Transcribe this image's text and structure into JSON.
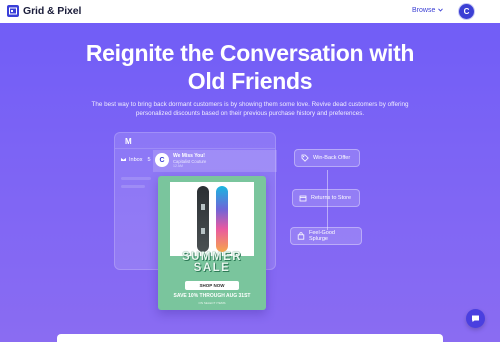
{
  "nav": {
    "brand": "Grid & Pixel",
    "browse_label": "Browse",
    "avatar_initial": "C"
  },
  "hero": {
    "title_line1": "Reignite the Conversation with",
    "title_line2": "Old Friends",
    "subtitle": "The best way to bring back dormant customers is by showing them some love. Revive dead customers by offering personalized discounts based on their previous purchase history and preferences."
  },
  "mail": {
    "logo": "M",
    "inbox_label": "Inbox",
    "inbox_count": "5",
    "email": {
      "avatar_initial": "C",
      "subject": "We Miss You!",
      "sender": "Capitalist Couture",
      "time": "12 AM"
    }
  },
  "promo": {
    "title_line1": "SUMMER",
    "title_line2": "SALE",
    "button": "SHOP NOW",
    "save_text": "SAVE 10% THROUGH AUG 31ST",
    "note": "ON SELECT ITEMS"
  },
  "flow": {
    "steps": [
      {
        "label": "Win-Back Offer",
        "icon": "tag-icon"
      },
      {
        "label": "Returns to Store",
        "icon": "store-icon"
      },
      {
        "label": "Feel-Good Splurge",
        "icon": "shopping-bag-icon"
      }
    ]
  },
  "colors": {
    "accent": "#3b3fd4",
    "background_gradient_top": "#6f5cf7",
    "promo_green": "#7ac59d"
  }
}
